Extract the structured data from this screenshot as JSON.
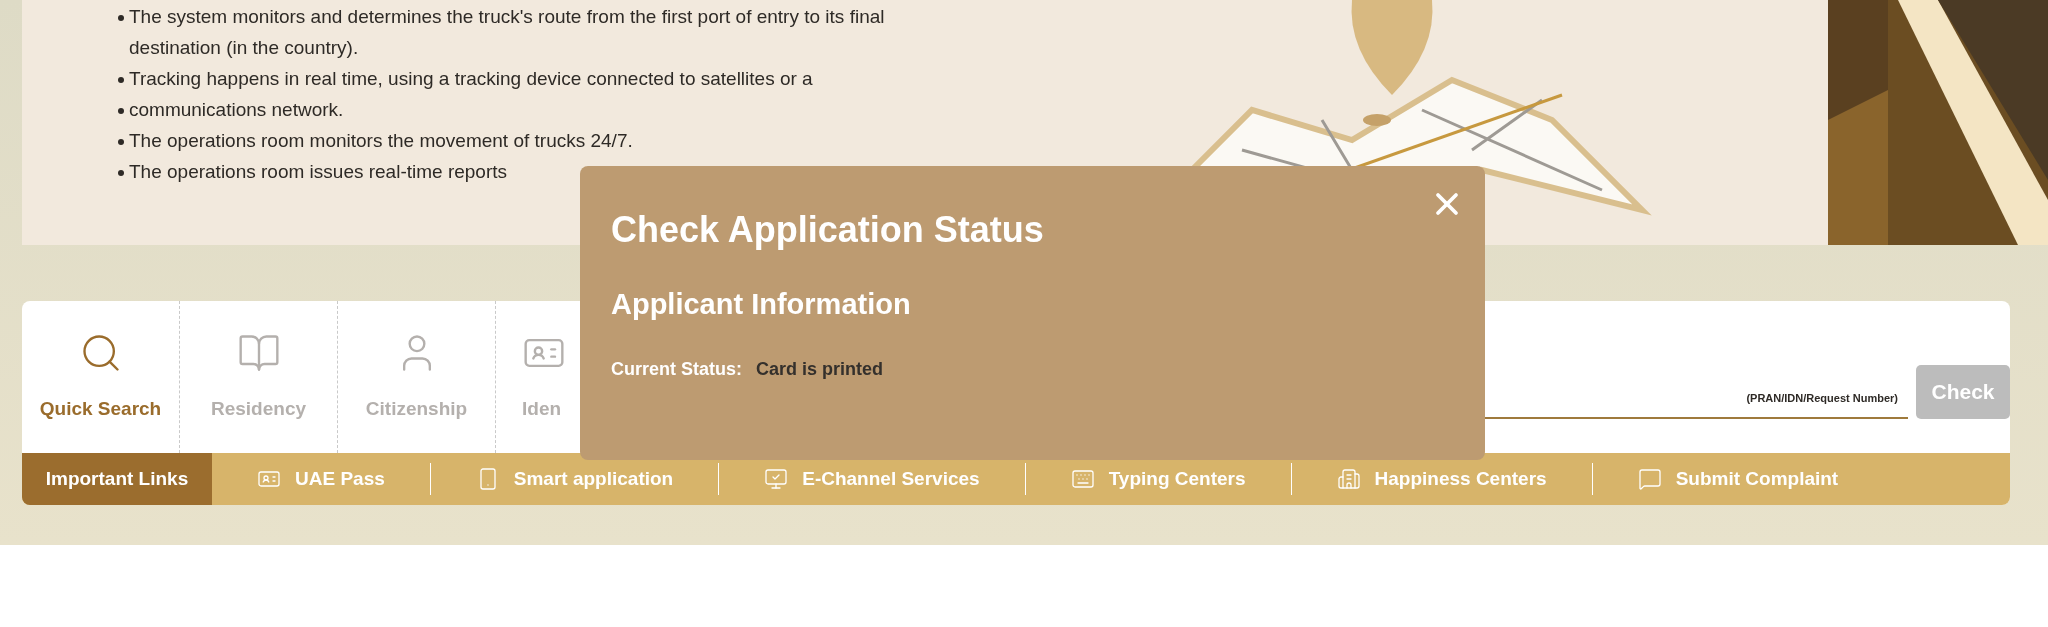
{
  "banner": {
    "lines": [
      {
        "text": "The system monitors and determines the truck's route from the first port of entry to its final",
        "bullet": true
      },
      {
        "text": "destination (in the country).",
        "bullet": false
      },
      {
        "text": "Tracking happens in real time, using a tracking device connected to satellites or a",
        "bullet": true
      },
      {
        "text": "communications network.",
        "bullet": true
      },
      {
        "text": "The operations room monitors the movement of trucks 24/7.",
        "bullet": true
      },
      {
        "text": "The operations room issues real-time reports",
        "bullet": true
      }
    ]
  },
  "tabs": [
    {
      "label": "Quick Search",
      "selected": true
    },
    {
      "label": "Residency",
      "selected": false
    },
    {
      "label": "Citizenship",
      "selected": false
    },
    {
      "label": "Iden",
      "selected": false
    }
  ],
  "search": {
    "placeholder": "(PRAN/IDN/Request Number)",
    "button": "Check",
    "disabled": true
  },
  "links": {
    "title": "Important Links",
    "items": [
      {
        "label": "UAE Pass"
      },
      {
        "label": "Smart application"
      },
      {
        "label": "E-Channel Services"
      },
      {
        "label": "Typing Centers"
      },
      {
        "label": "Happiness Centers"
      },
      {
        "label": "Submit Complaint"
      }
    ]
  },
  "modal": {
    "title": "Check Application Status",
    "subtitle": "Applicant Information",
    "field_label": "Current Status:",
    "field_value": "Card is printed"
  }
}
